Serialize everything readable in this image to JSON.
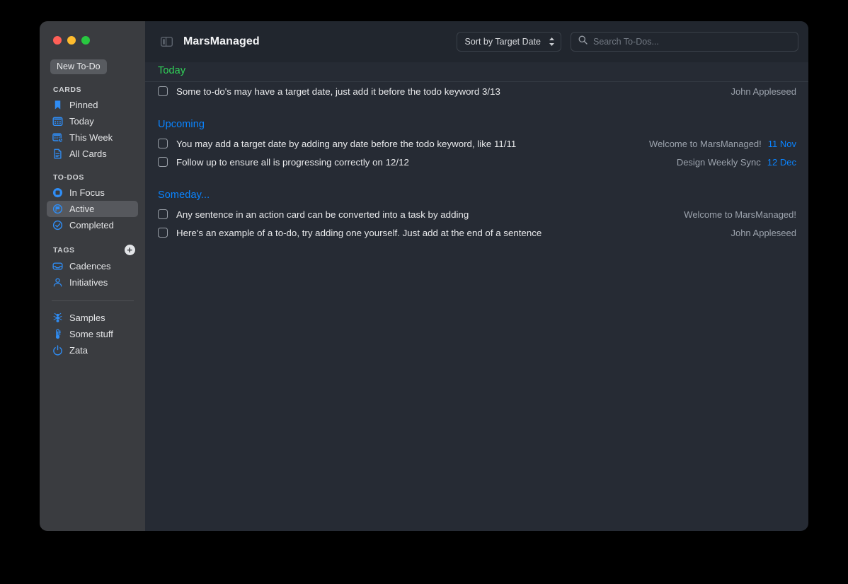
{
  "window": {
    "traffic_lights": [
      {
        "name": "close",
        "color": "#ff5f57"
      },
      {
        "name": "minimize",
        "color": "#febc2e"
      },
      {
        "name": "zoom",
        "color": "#28c840"
      }
    ]
  },
  "sidebar": {
    "new_todo_label": "New To-Do",
    "sections": [
      {
        "title": "CARDS",
        "items": [
          {
            "label": "Pinned",
            "icon": "bookmark-icon",
            "selected": false
          },
          {
            "label": "Today",
            "icon": "calendar-icon",
            "selected": false
          },
          {
            "label": "This Week",
            "icon": "calendar-week-icon",
            "selected": false
          },
          {
            "label": "All Cards",
            "icon": "document-icon",
            "selected": false
          }
        ]
      },
      {
        "title": "TO-DOS",
        "items": [
          {
            "label": "In Focus",
            "icon": "focus-icon",
            "selected": false
          },
          {
            "label": "Active",
            "icon": "active-flag-icon",
            "selected": true
          },
          {
            "label": "Completed",
            "icon": "check-circle-icon",
            "selected": false
          }
        ]
      },
      {
        "title": "TAGS",
        "add_button": "+",
        "items": [
          {
            "label": "Cadences",
            "icon": "tray-icon",
            "selected": false
          },
          {
            "label": "Initiatives",
            "icon": "person-icon",
            "selected": false
          }
        ]
      },
      {
        "title": "",
        "items": [
          {
            "label": "Samples",
            "icon": "ant-icon",
            "selected": false
          },
          {
            "label": "Some stuff",
            "icon": "thermometer-icon",
            "selected": false
          },
          {
            "label": "Zata",
            "icon": "power-icon",
            "selected": false
          }
        ]
      }
    ]
  },
  "toolbar": {
    "sidebar_toggle": "sidebar-toggle-icon",
    "title": "MarsManaged",
    "sort_label": "Sort by Target Date",
    "search_placeholder": "Search To-Dos...",
    "search_value": ""
  },
  "colors": {
    "today_green": "#30d158",
    "accent_blue": "#0a84ff",
    "sidebar_bg": "#3a3c40",
    "main_bg": "#262b34",
    "toolbar_bg": "#21262e"
  },
  "groups": [
    {
      "name": "Today",
      "style": "today",
      "todos": [
        {
          "text": "Some to-do's may have a target date, just add it before the todo keyword 3/13",
          "card": "John Appleseed",
          "date": "",
          "checked": false
        }
      ]
    },
    {
      "name": "Upcoming",
      "style": "blue",
      "todos": [
        {
          "text": "You may add a target date by adding any date before the todo keyword, like 11/11",
          "card": "Welcome to MarsManaged!",
          "date": "11 Nov",
          "checked": false
        },
        {
          "text": "Follow up to ensure all is progressing correctly on 12/12",
          "card": "Design Weekly Sync",
          "date": "12 Dec",
          "checked": false
        }
      ]
    },
    {
      "name": "Someday...",
      "style": "blue",
      "todos": [
        {
          "text": "Any sentence in an action card can be converted into a task by adding",
          "card": "Welcome to MarsManaged!",
          "date": "",
          "checked": false
        },
        {
          "text": "Here's an example of a to-do, try adding one yourself. Just add at the end of a sentence",
          "card": "John Appleseed",
          "date": "",
          "checked": false
        }
      ]
    }
  ]
}
